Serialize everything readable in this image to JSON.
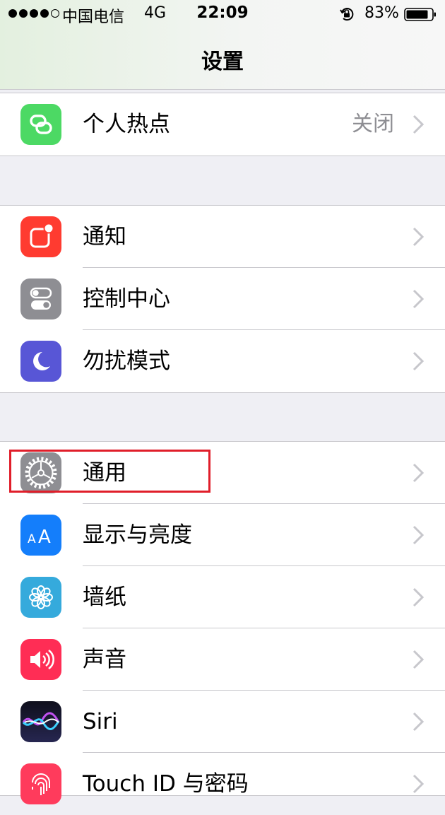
{
  "status_bar": {
    "carrier": "中国电信",
    "network": "4G",
    "time": "22:09",
    "battery_percent": "83%"
  },
  "nav": {
    "title": "设置"
  },
  "groups": [
    {
      "items": [
        {
          "label": "个人热点",
          "value": "关闭",
          "icon": "hotspot-icon",
          "color": "#4cd964"
        }
      ]
    },
    {
      "items": [
        {
          "label": "通知",
          "icon": "notifications-icon",
          "color": "#ff3b30"
        },
        {
          "label": "控制中心",
          "icon": "control-center-icon",
          "color": "#8e8e93"
        },
        {
          "label": "勿扰模式",
          "icon": "moon-icon",
          "color": "#5856d6"
        }
      ]
    },
    {
      "items": [
        {
          "label": "通用",
          "icon": "gear-icon",
          "color": "#8e8e93"
        },
        {
          "label": "显示与亮度",
          "icon": "display-icon",
          "color": "#147efb"
        },
        {
          "label": "墙纸",
          "icon": "wallpaper-icon",
          "color": "#35aadc"
        },
        {
          "label": "声音",
          "icon": "speaker-icon",
          "color": "#ff2d55"
        },
        {
          "label": "Siri",
          "icon": "siri-icon",
          "color": "#1b1b3a"
        },
        {
          "label": "Touch ID 与密码",
          "icon": "fingerprint-icon",
          "color": "#ff3b5c"
        }
      ]
    }
  ]
}
